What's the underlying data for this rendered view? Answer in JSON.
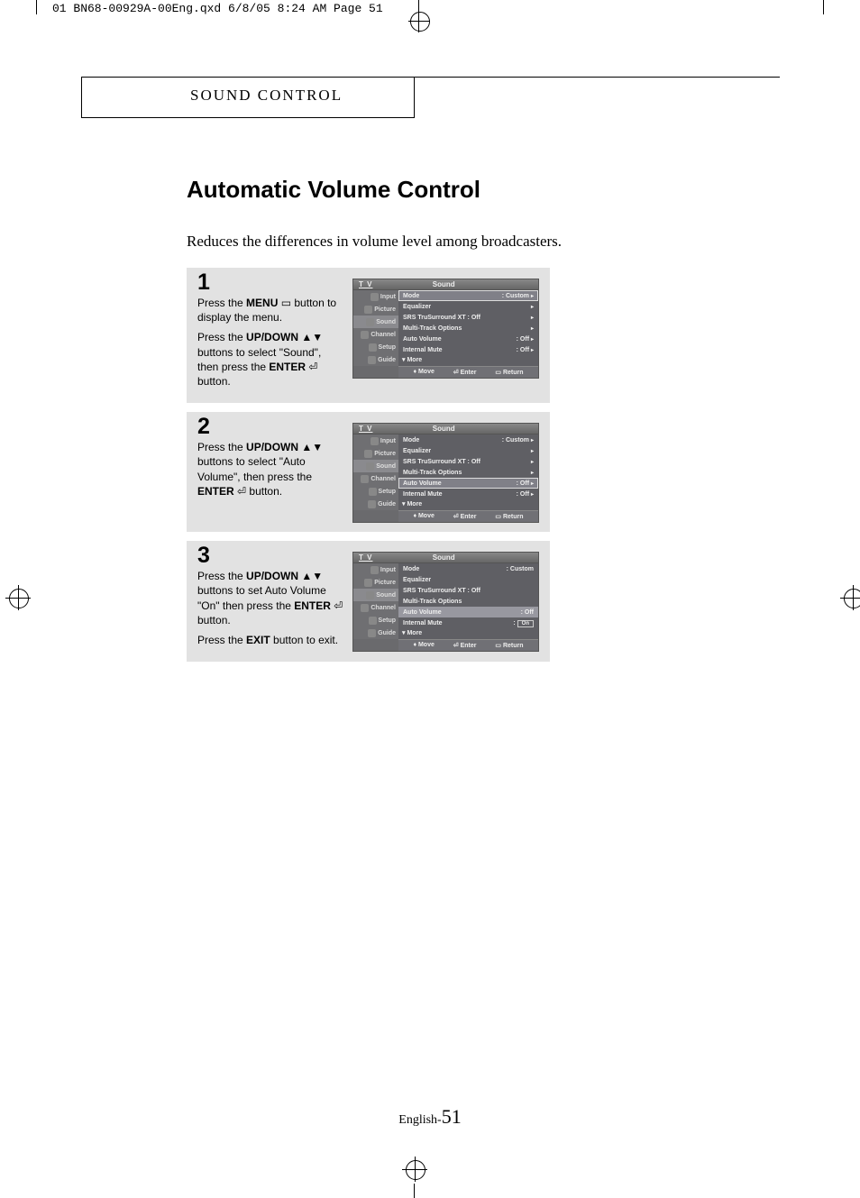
{
  "print_header": "01 BN68-00929A-00Eng.qxd  6/8/05 8:24 AM  Page 51",
  "section_title": "SOUND CONTROL",
  "page_title": "Automatic Volume Control",
  "intro": "Reduces the differences in volume level among broadcasters.",
  "steps": [
    {
      "num": "1",
      "paragraphs": [
        "Press the <b>MENU</b> ▭ button to display the menu.",
        "Press the <b>UP/DOWN</b> ▲▼ buttons to select \"Sound\", then press the <b>ENTER</b> ⏎ button."
      ],
      "panel": {
        "tv": "T V",
        "title": "Sound",
        "sidebar": [
          "Input",
          "Picture",
          "Sound",
          "Channel",
          "Setup",
          "Guide"
        ],
        "sidebar_sel": 2,
        "rows": [
          {
            "label": "Mode",
            "val": ": Custom",
            "hl": true,
            "arrow": true
          },
          {
            "label": "Equalizer",
            "val": "",
            "arrow": true
          },
          {
            "label": "SRS TruSurround XT : Off",
            "val": "",
            "arrow": true
          },
          {
            "label": "Multi-Track Options",
            "val": "",
            "arrow": true
          },
          {
            "label": "Auto Volume",
            "val": ": Off",
            "arrow": true
          },
          {
            "label": "Internal Mute",
            "val": ": Off",
            "arrow": true
          }
        ],
        "more": "▾ More",
        "footer": [
          "♦ Move",
          "⏎ Enter",
          "▭ Return"
        ]
      }
    },
    {
      "num": "2",
      "paragraphs": [
        "Press the <b>UP/DOWN</b> ▲▼ buttons to select \"Auto Volume\", then press the <b>ENTER</b> ⏎ button."
      ],
      "panel": {
        "tv": "T V",
        "title": "Sound",
        "sidebar": [
          "Input",
          "Picture",
          "Sound",
          "Channel",
          "Setup",
          "Guide"
        ],
        "sidebar_sel": 2,
        "rows": [
          {
            "label": "Mode",
            "val": ": Custom",
            "arrow": true
          },
          {
            "label": "Equalizer",
            "val": "",
            "arrow": true
          },
          {
            "label": "SRS TruSurround XT : Off",
            "val": "",
            "arrow": true
          },
          {
            "label": "Multi-Track Options",
            "val": "",
            "arrow": true
          },
          {
            "label": "Auto Volume",
            "val": ": Off",
            "hl": true,
            "arrow": true
          },
          {
            "label": "Internal Mute",
            "val": ": Off",
            "arrow": true
          }
        ],
        "more": "▾ More",
        "footer": [
          "♦ Move",
          "⏎ Enter",
          "▭ Return"
        ]
      }
    },
    {
      "num": "3",
      "paragraphs": [
        "Press the <b>UP/DOWN</b> ▲▼ buttons  to set Auto Volume \"On\" then press the <b>ENTER</b> ⏎ button.",
        "Press the <b>EXIT</b> button to exit."
      ],
      "panel": {
        "tv": "T V",
        "title": "Sound",
        "sidebar": [
          "Input",
          "Picture",
          "Sound",
          "Channel",
          "Setup",
          "Guide"
        ],
        "sidebar_sel": 2,
        "rows": [
          {
            "label": "Mode",
            "val": ": Custom"
          },
          {
            "label": "Equalizer",
            "val": ""
          },
          {
            "label": "SRS TruSurround XT : Off",
            "val": ""
          },
          {
            "label": "Multi-Track Options",
            "val": ""
          },
          {
            "label": "Auto Volume",
            "val": ": Off",
            "hl_dark": true
          },
          {
            "label": "Internal Mute",
            "val": ":",
            "valbox": "On"
          }
        ],
        "more": "▾ More",
        "footer": [
          "♦ Move",
          "⏎ Enter",
          "▭ Return"
        ]
      }
    }
  ],
  "page_number_prefix": "English-",
  "page_number": "51"
}
